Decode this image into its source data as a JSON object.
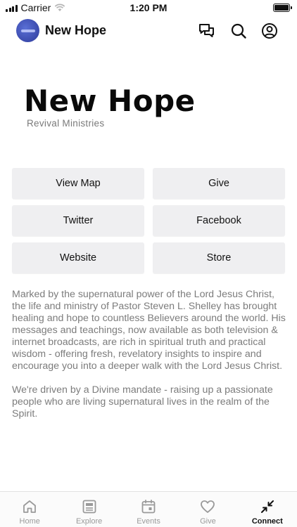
{
  "status_bar": {
    "carrier": "Carrier",
    "time": "1:20 PM"
  },
  "header": {
    "title": "New Hope",
    "icons": [
      "avatar",
      "chat-icon",
      "search-icon",
      "profile-icon"
    ]
  },
  "logo": {
    "title": "New Hope",
    "subtitle": "Revival Ministries"
  },
  "buttons": [
    {
      "label": "View Map"
    },
    {
      "label": "Give"
    },
    {
      "label": "Twitter"
    },
    {
      "label": "Facebook"
    },
    {
      "label": "Website"
    },
    {
      "label": "Store"
    }
  ],
  "description": {
    "p1": "Marked by the supernatural power of the Lord Jesus Christ, the life and ministry of Pastor Steven L. Shelley has brought healing and hope to countless Believers around the world. His messages and teachings, now available as both television & internet broadcasts, are rich in spiritual truth and practical wisdom - offering fresh, revelatory insights to inspire and encourage you into a deeper walk with the Lord Jesus Christ.",
    "p2": "We're driven by a Divine mandate - raising up a passionate people who are living supernatural lives in the realm of the Spirit."
  },
  "tabs": [
    {
      "label": "Home",
      "icon": "home-icon",
      "active": false
    },
    {
      "label": "Explore",
      "icon": "explore-icon",
      "active": false
    },
    {
      "label": "Events",
      "icon": "calendar-icon",
      "active": false
    },
    {
      "label": "Give",
      "icon": "heart-icon",
      "active": false
    },
    {
      "label": "Connect",
      "icon": "connect-icon",
      "active": true
    }
  ],
  "colors": {
    "active_tab": "#111111",
    "inactive_tab": "#9a9a9a",
    "button_bg": "#efeff1",
    "body_text": "#7c7c7c"
  }
}
